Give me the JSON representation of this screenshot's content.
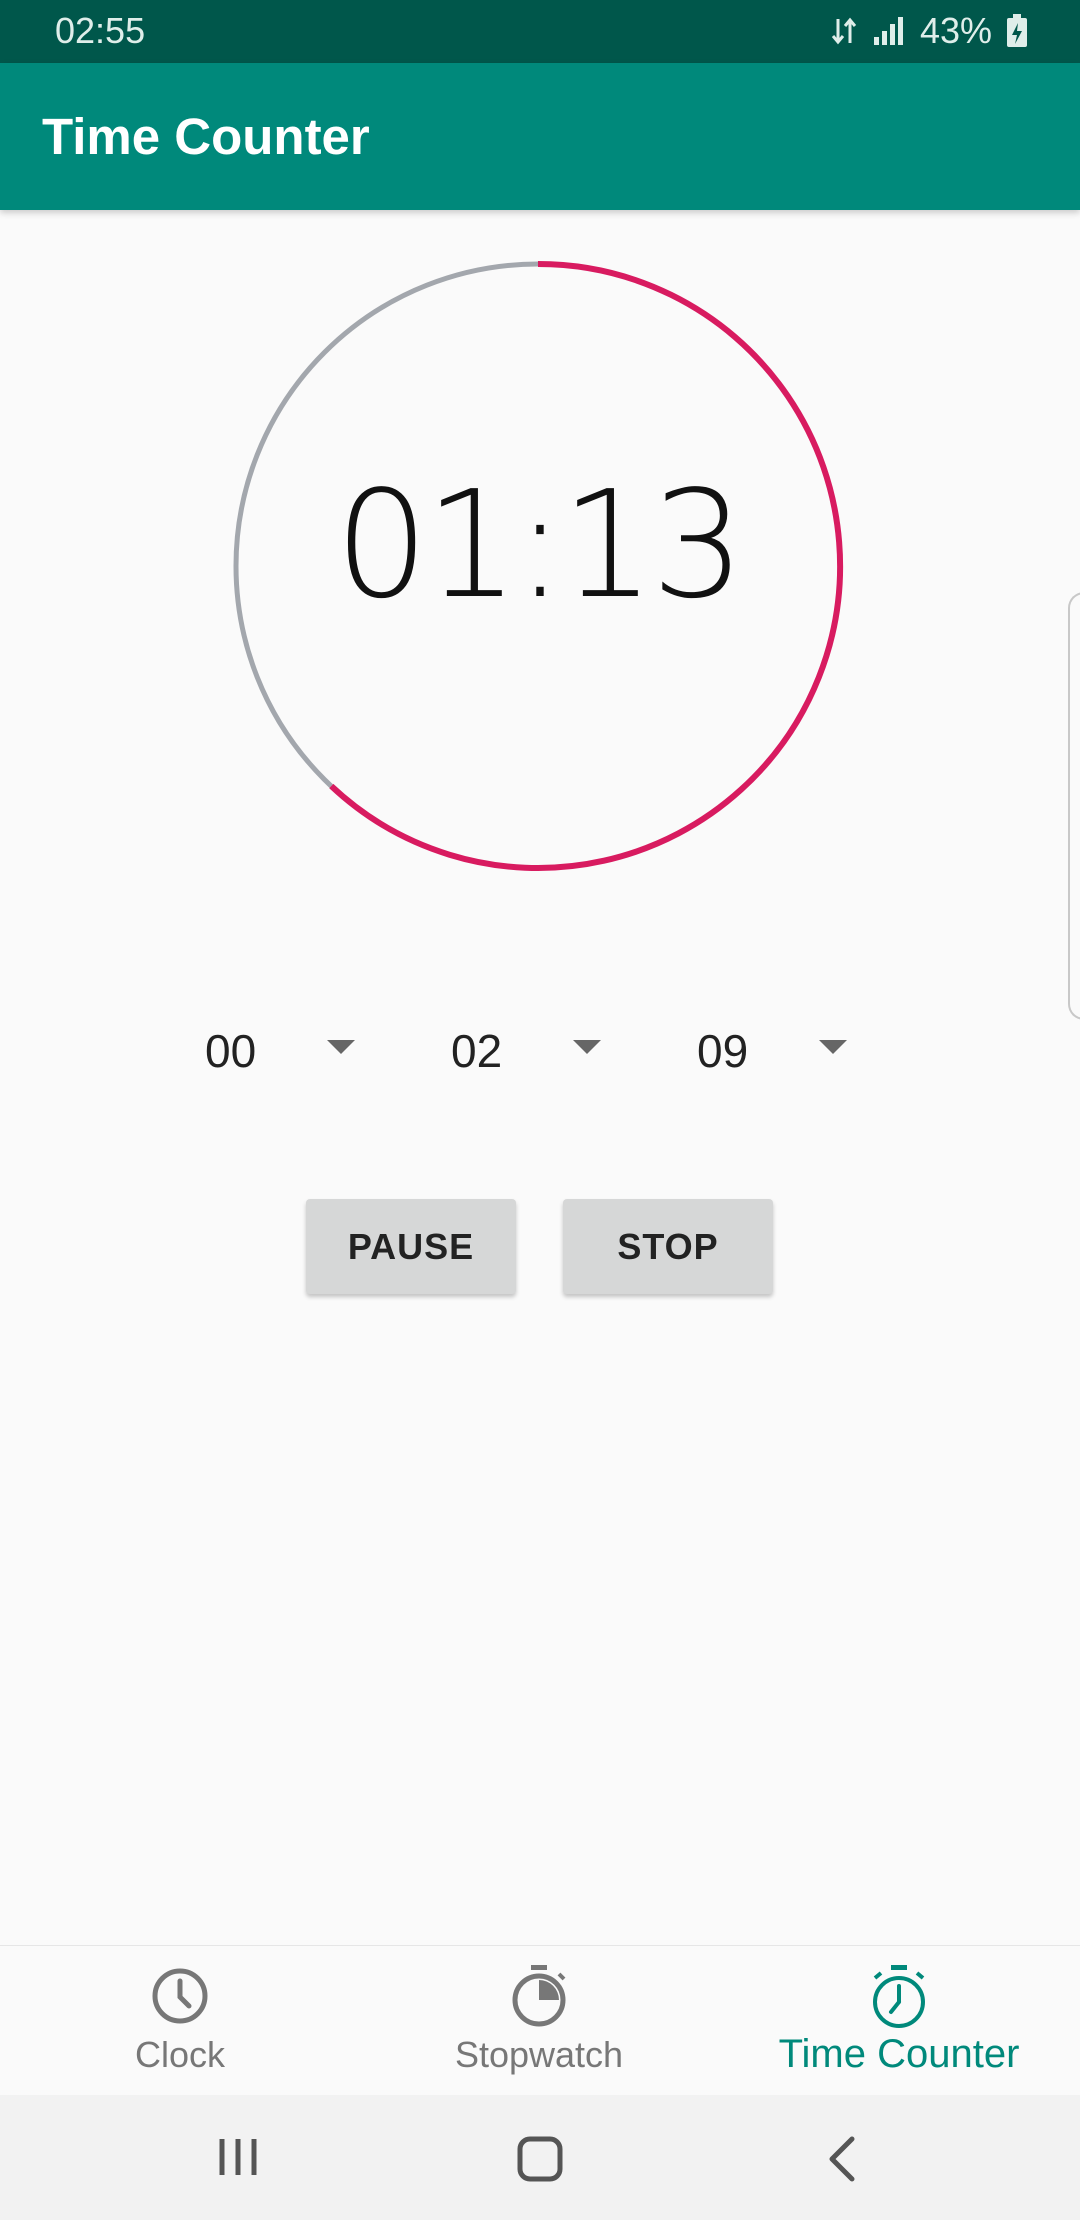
{
  "status_bar": {
    "time": "02:55",
    "network_icon": "data-transfer-icon",
    "signal_icon": "signal-icon",
    "battery_percent": "43%",
    "battery_icon": "battery-charging-icon"
  },
  "app_bar": {
    "title": "Time Counter"
  },
  "timer": {
    "display": "01:13",
    "progress_fraction": 0.62,
    "colors": {
      "remaining": "#d81b60",
      "elapsed": "#a3a7ad"
    }
  },
  "pickers": [
    {
      "value": "00"
    },
    {
      "value": "02"
    },
    {
      "value": "09"
    }
  ],
  "buttons": {
    "pause": "PAUSE",
    "stop": "STOP"
  },
  "bottom_nav": [
    {
      "label": "Clock",
      "icon": "clock-icon",
      "active": false
    },
    {
      "label": "Stopwatch",
      "icon": "stopwatch-icon",
      "active": false
    },
    {
      "label": "Time Counter",
      "icon": "timer-icon",
      "active": true
    }
  ],
  "colors": {
    "primary": "#00897b",
    "primary_dark": "#00574b",
    "accent": "#d81b60"
  },
  "system_nav": {
    "recent": "recent-apps-icon",
    "home": "home-icon",
    "back": "back-icon"
  }
}
